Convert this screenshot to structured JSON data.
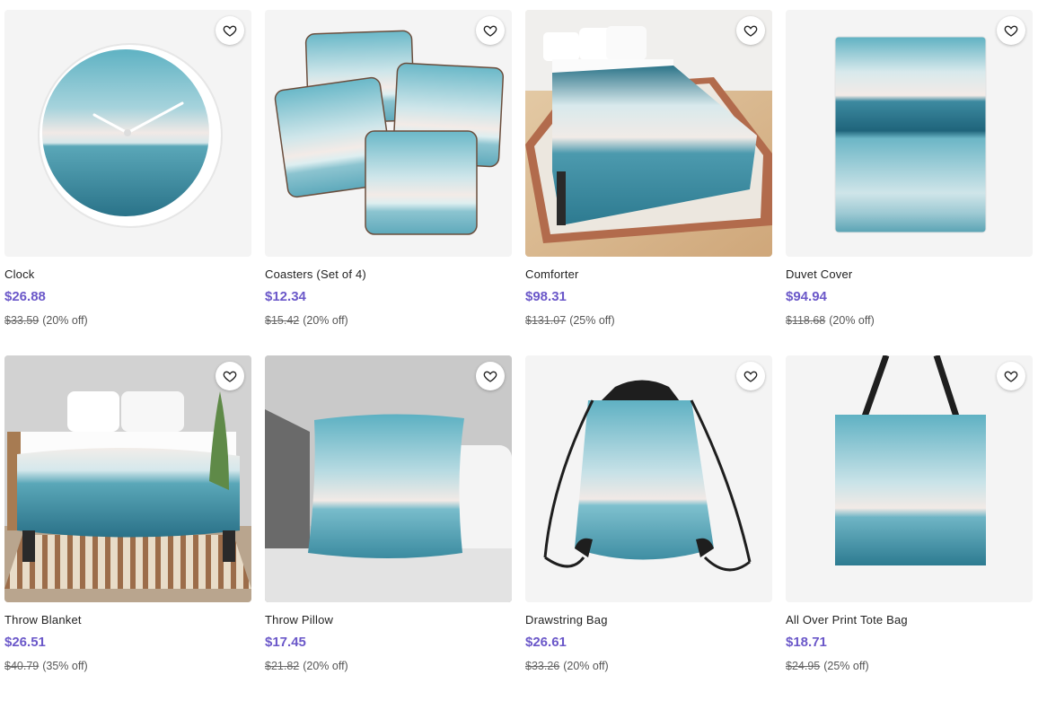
{
  "products": [
    {
      "title": "Clock",
      "price": "$26.88",
      "old_price": "$33.59",
      "discount": "(20% off)",
      "icon": "clock-product"
    },
    {
      "title": "Coasters (Set of 4)",
      "price": "$12.34",
      "old_price": "$15.42",
      "discount": "(20% off)",
      "icon": "coasters-product"
    },
    {
      "title": "Comforter",
      "price": "$98.31",
      "old_price": "$131.07",
      "discount": "(25% off)",
      "icon": "comforter-product"
    },
    {
      "title": "Duvet Cover",
      "price": "$94.94",
      "old_price": "$118.68",
      "discount": "(20% off)",
      "icon": "duvet-product"
    },
    {
      "title": "Throw Blanket",
      "price": "$26.51",
      "old_price": "$40.79",
      "discount": "(35% off)",
      "icon": "blanket-product"
    },
    {
      "title": "Throw Pillow",
      "price": "$17.45",
      "old_price": "$21.82",
      "discount": "(20% off)",
      "icon": "pillow-product"
    },
    {
      "title": "Drawstring Bag",
      "price": "$26.61",
      "old_price": "$33.26",
      "discount": "(20% off)",
      "icon": "drawstring-bag-product"
    },
    {
      "title": "All Over Print Tote Bag",
      "price": "$18.71",
      "old_price": "$24.95",
      "discount": "(25% off)",
      "icon": "tote-bag-product"
    }
  ],
  "colors": {
    "price": "#6b58c9",
    "ocean_top": "#5fb2c3",
    "ocean_deep": "#276f86"
  }
}
